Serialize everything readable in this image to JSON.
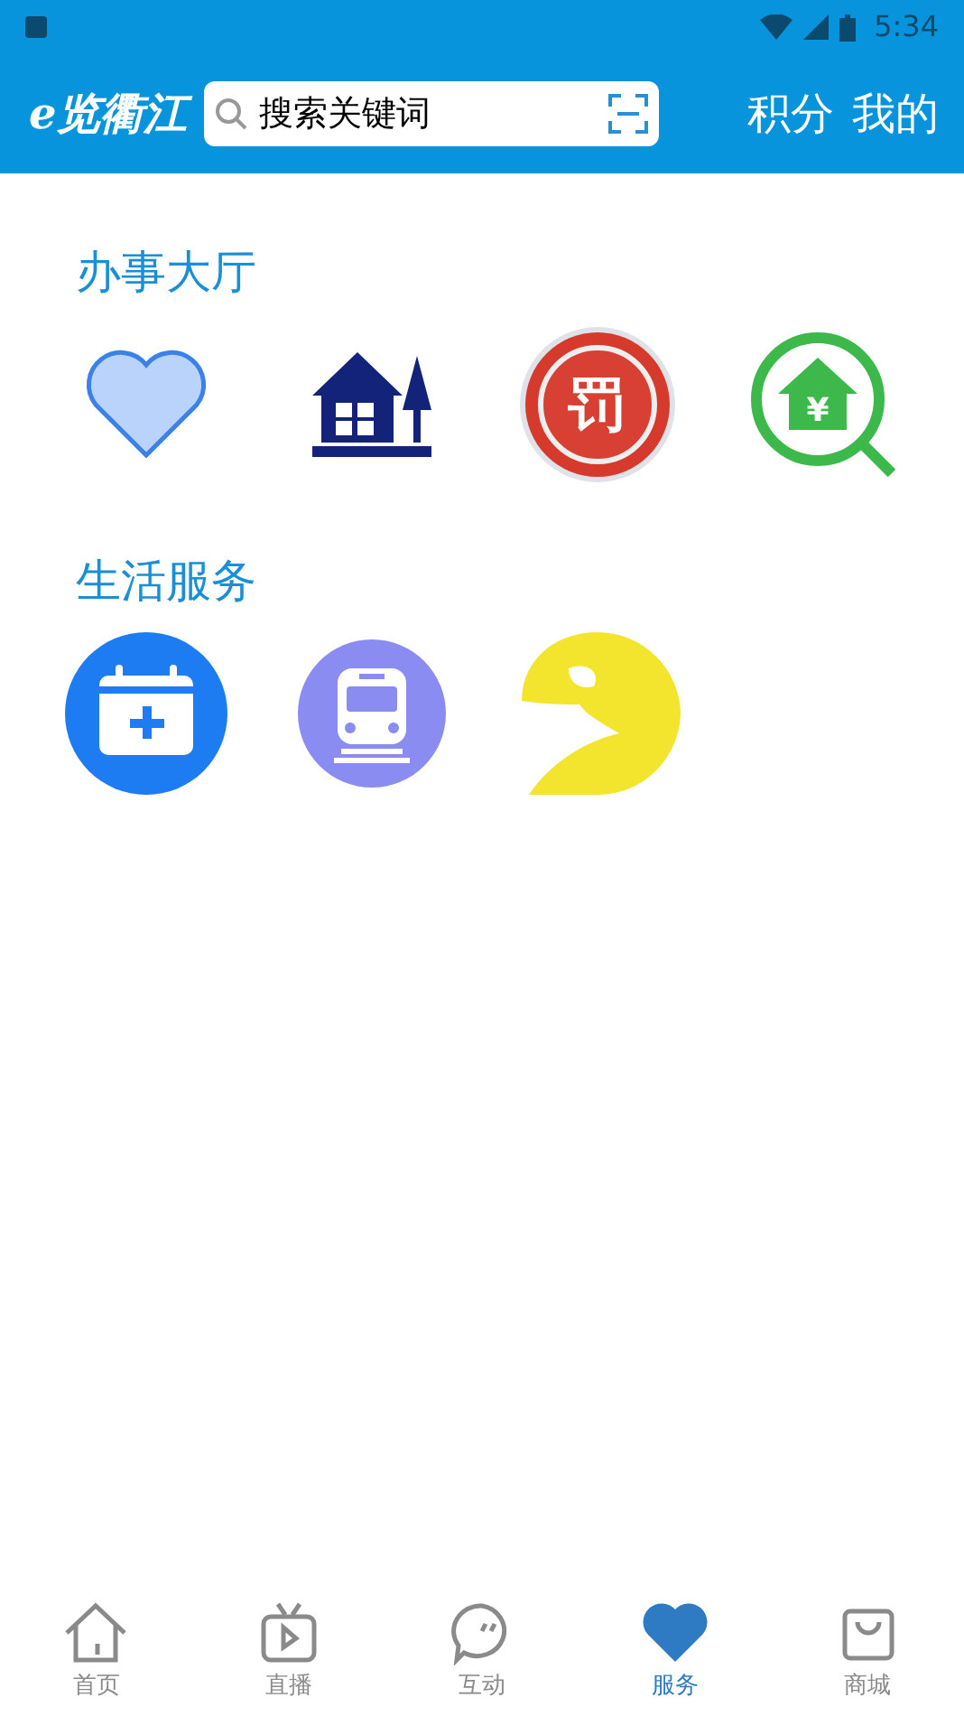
{
  "status_bar": {
    "time": "5:34"
  },
  "header": {
    "logo": "e览衢江",
    "search": {
      "placeholder": "搜索关键词"
    },
    "actions": [
      "积分",
      "我的"
    ]
  },
  "sections": [
    {
      "title": "办事大厅",
      "items": [
        {
          "kind": "heart"
        },
        {
          "kind": "house"
        },
        {
          "kind": "fine",
          "glyph": "罚"
        },
        {
          "kind": "fund",
          "glyph": "¥"
        }
      ]
    },
    {
      "title": "生活服务",
      "items": [
        {
          "kind": "calendar"
        },
        {
          "kind": "train"
        },
        {
          "kind": "moon"
        }
      ]
    }
  ],
  "tabs": [
    {
      "label": "首页",
      "kind": "home",
      "selected": false
    },
    {
      "label": "直播",
      "kind": "tv",
      "selected": false
    },
    {
      "label": "互动",
      "kind": "chat",
      "selected": false
    },
    {
      "label": "服务",
      "kind": "heart",
      "selected": true
    },
    {
      "label": "商城",
      "kind": "shop",
      "selected": false
    }
  ]
}
